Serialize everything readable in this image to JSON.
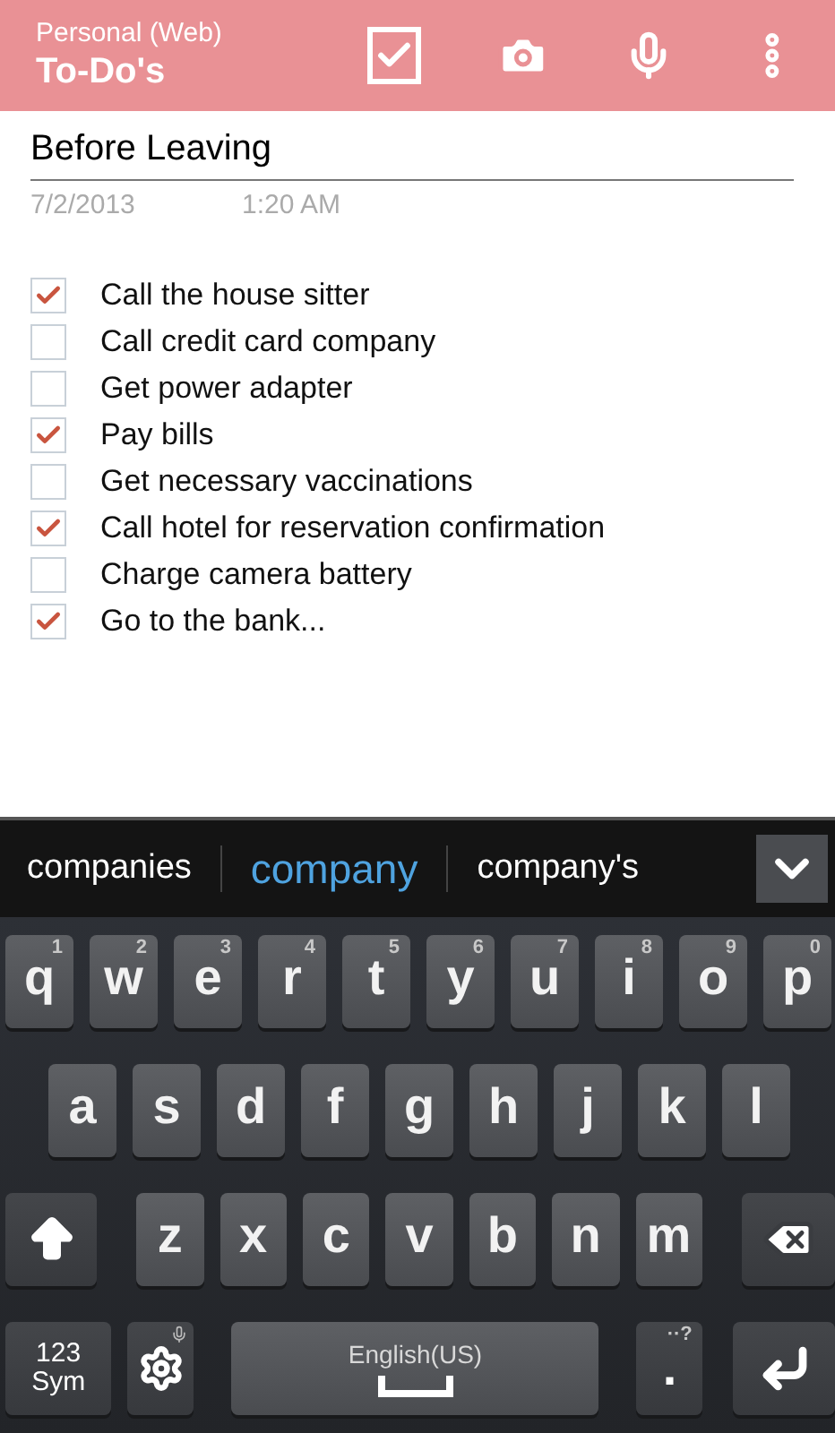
{
  "header": {
    "account": "Personal (Web)",
    "title": "To-Do's"
  },
  "note": {
    "title": "Before Leaving",
    "date": "7/2/2013",
    "time": "1:20 AM"
  },
  "items": [
    {
      "text": "Call the house sitter",
      "checked": true
    },
    {
      "text": "Call credit card company",
      "checked": false
    },
    {
      "text": "Get power adapter",
      "checked": false
    },
    {
      "text": "Pay bills",
      "checked": true
    },
    {
      "text": "Get necessary vaccinations",
      "checked": false
    },
    {
      "text": "Call hotel for reservation confirmation",
      "checked": true
    },
    {
      "text": "Charge camera battery",
      "checked": false
    },
    {
      "text": "Go to the bank...",
      "checked": true
    }
  ],
  "suggestions": [
    {
      "text": "companies",
      "selected": false
    },
    {
      "text": "company",
      "selected": true
    },
    {
      "text": "company's",
      "selected": false
    }
  ],
  "keyboard": {
    "top_row": [
      {
        "kind": "letter",
        "label": "q",
        "hint": "1"
      },
      {
        "kind": "letter",
        "label": "w",
        "hint": "2"
      },
      {
        "kind": "letter",
        "label": "e",
        "hint": "3"
      },
      {
        "kind": "letter",
        "label": "r",
        "hint": "4"
      },
      {
        "kind": "letter",
        "label": "t",
        "hint": "5"
      },
      {
        "kind": "letter",
        "label": "y",
        "hint": "6"
      },
      {
        "kind": "letter",
        "label": "u",
        "hint": "7"
      },
      {
        "kind": "letter",
        "label": "i",
        "hint": "8"
      },
      {
        "kind": "letter",
        "label": "o",
        "hint": "9"
      },
      {
        "kind": "letter",
        "label": "p",
        "hint": "0"
      }
    ],
    "middle_row": [
      {
        "kind": "letter",
        "label": "a"
      },
      {
        "kind": "letter",
        "label": "s"
      },
      {
        "kind": "letter",
        "label": "d"
      },
      {
        "kind": "letter",
        "label": "f"
      },
      {
        "kind": "letter",
        "label": "g"
      },
      {
        "kind": "letter",
        "label": "h"
      },
      {
        "kind": "letter",
        "label": "j"
      },
      {
        "kind": "letter",
        "label": "k"
      },
      {
        "kind": "letter",
        "label": "l"
      }
    ],
    "lower_row": [
      {
        "kind": "shift"
      },
      {
        "kind": "letter",
        "label": "z"
      },
      {
        "kind": "letter",
        "label": "x"
      },
      {
        "kind": "letter",
        "label": "c"
      },
      {
        "kind": "letter",
        "label": "v"
      },
      {
        "kind": "letter",
        "label": "b"
      },
      {
        "kind": "letter",
        "label": "n"
      },
      {
        "kind": "letter",
        "label": "m"
      },
      {
        "kind": "backspace"
      }
    ],
    "bottom_row": [
      {
        "kind": "symbols",
        "label": "123 Sym"
      },
      {
        "kind": "settings"
      },
      {
        "kind": "space",
        "label": "English(US)"
      },
      {
        "kind": "period",
        "label": ".",
        "hint": "··?"
      },
      {
        "kind": "enter"
      }
    ]
  }
}
